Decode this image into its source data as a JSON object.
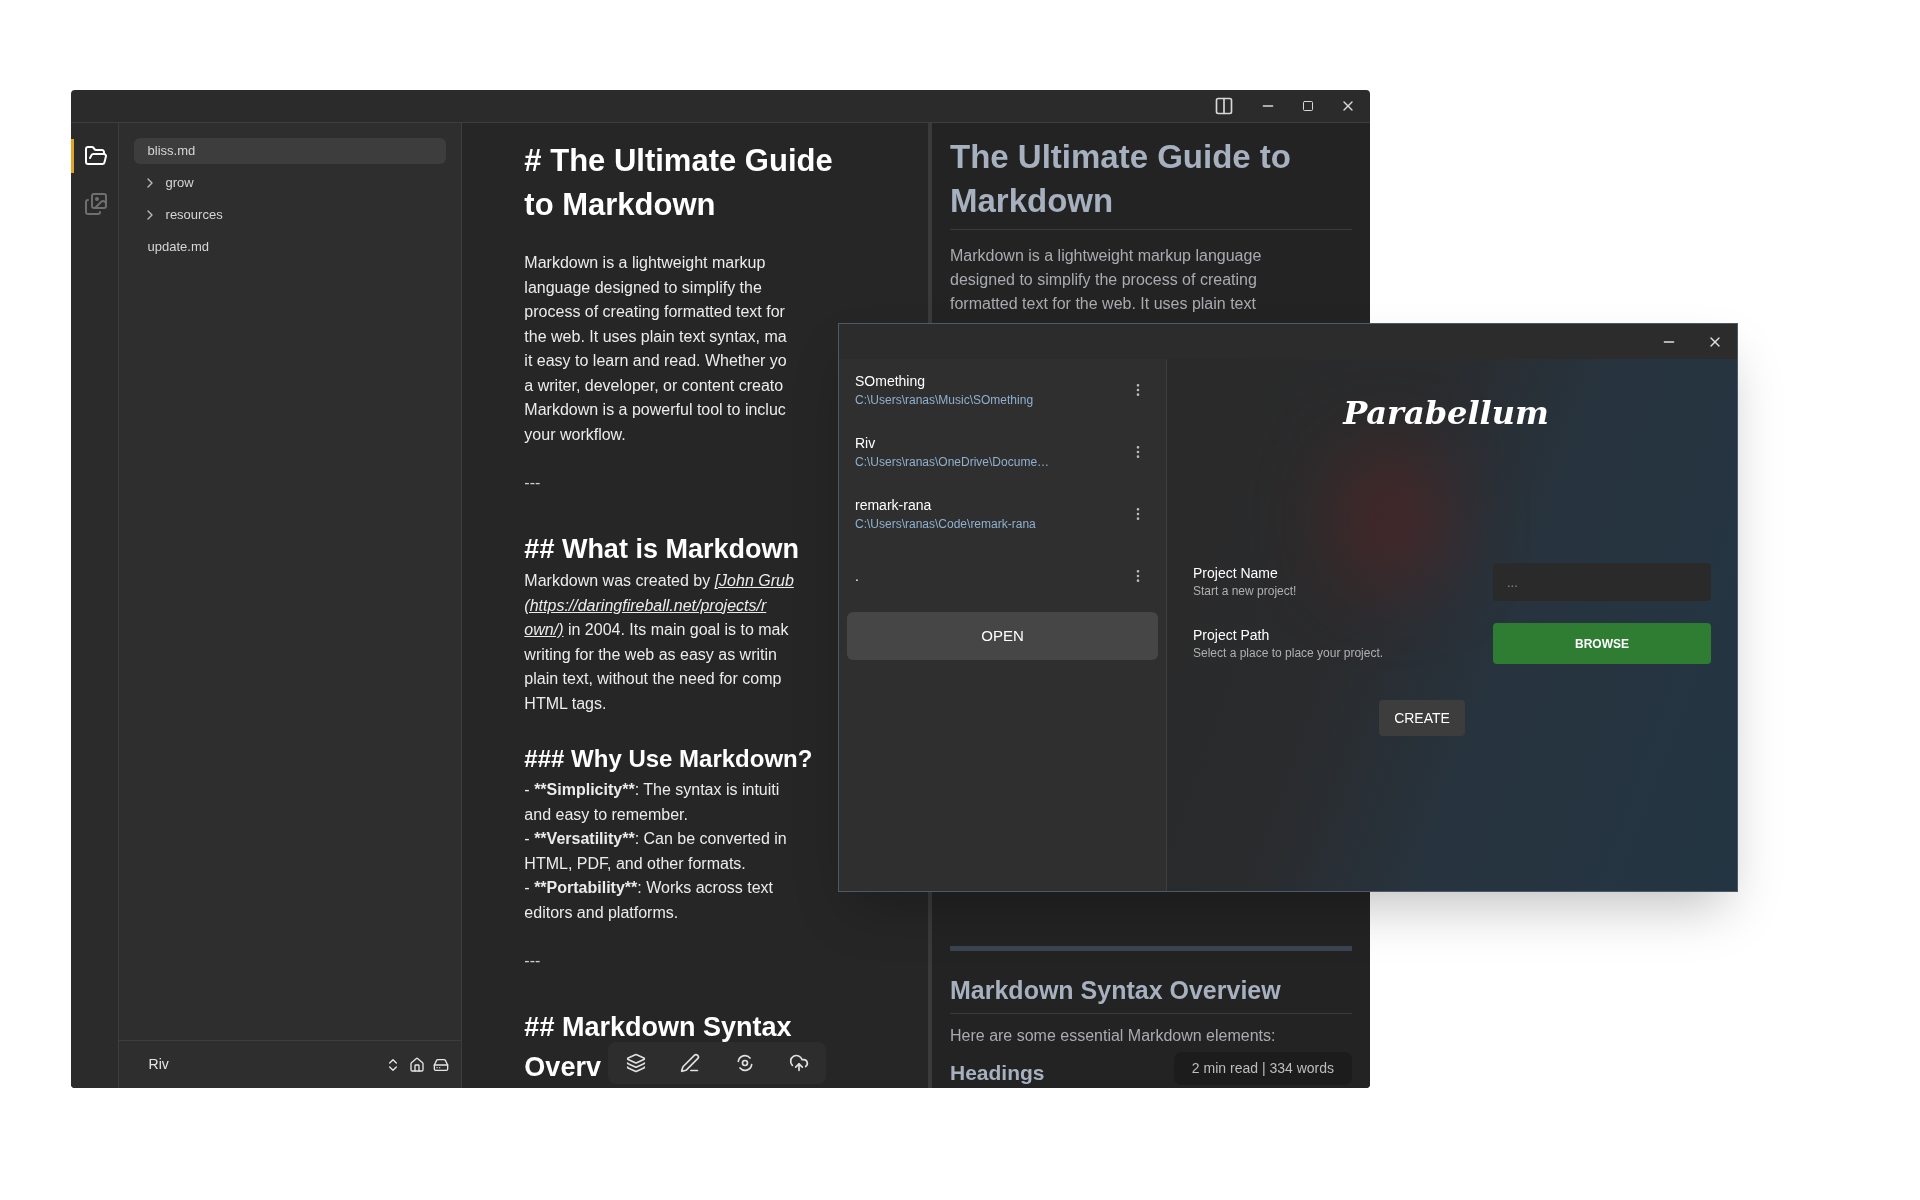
{
  "activity_bar": [
    {
      "kind": "files",
      "selected": true
    },
    {
      "kind": "images",
      "selected": false
    }
  ],
  "file_tree": {
    "items": [
      {
        "name": "bliss.md",
        "kind": "file",
        "selected": true
      },
      {
        "name": "grow",
        "kind": "folder",
        "selected": false
      },
      {
        "name": "resources",
        "kind": "folder",
        "selected": false
      },
      {
        "name": "update.md",
        "kind": "file",
        "selected": false
      }
    ],
    "footer": {
      "project": "Riv"
    }
  },
  "editor": {
    "blocks": [
      {
        "kind": "h1",
        "lines": [
          "# The Ultimate Guide",
          "to Markdown"
        ]
      },
      {
        "kind": "paragraph",
        "lines": [
          "Markdown is a lightweight markup",
          "language designed to simplify the",
          "process of creating formatted text for",
          "the web. It uses plain text syntax, ma",
          "it easy to learn and read. Whether yo",
          "a writer, developer, or content creato",
          "Markdown is a powerful tool to incluc",
          "your workflow."
        ]
      },
      {
        "kind": "rule",
        "lines": [
          "---"
        ]
      },
      {
        "kind": "h2",
        "lines": [
          "## What is Markdown"
        ]
      },
      {
        "kind": "paragraph",
        "lines": [
          [
            {
              "text": "Markdown was created by "
            },
            {
              "text": "[John Grub",
              "kind": "link"
            }
          ],
          [
            {
              "text": "(https://daringfireball.net/projects/r",
              "kind": "link"
            }
          ],
          [
            {
              "text": "own/)",
              "kind": "link"
            },
            {
              "text": " in 2004. Its main goal is to mak"
            }
          ],
          "writing for the web as easy as writin",
          "plain text, without the need for comp",
          "HTML tags."
        ]
      },
      {
        "kind": "h3",
        "lines": [
          "### Why Use Markdown?"
        ]
      },
      {
        "kind": "paragraph",
        "lines": [
          [
            {
              "text": "- "
            },
            {
              "text": "**Simplicity**",
              "kind": "bold"
            },
            {
              "text": ": The syntax is intuiti"
            }
          ],
          "and easy to remember.",
          [
            {
              "text": "- "
            },
            {
              "text": "**Versatility**",
              "kind": "bold"
            },
            {
              "text": ": Can be converted in"
            }
          ],
          "HTML, PDF, and other formats.",
          [
            {
              "text": "- "
            },
            {
              "text": "**Portability**",
              "kind": "bold"
            },
            {
              "text": ": Works across text"
            }
          ],
          "editors and platforms."
        ]
      },
      {
        "kind": "rule",
        "lines": [
          "---"
        ]
      },
      {
        "kind": "h2",
        "lines": [
          "## Markdown Syntax",
          "Overv"
        ]
      }
    ]
  },
  "preview": {
    "title": "The Ultimate Guide to Markdown",
    "intro_lines": [
      "Markdown is a lightweight markup language",
      "designed to simplify the process of creating",
      "formatted text for the web. It uses plain text"
    ],
    "heading": "Markdown Syntax Overview",
    "paragraph": "Here are some essential Markdown elements:",
    "subheading": "Headings",
    "reading_stats": "2 min read | 334 words"
  },
  "dialog": {
    "projects": [
      {
        "name": "SOmething",
        "path": "C:\\Users\\ranas\\Music\\SOmething"
      },
      {
        "name": "Riv",
        "path": "C:\\Users\\ranas\\OneDrive\\Docume…"
      },
      {
        "name": "remark-rana",
        "path": "C:\\Users\\ranas\\Code\\remark-rana"
      },
      {
        "name": "."
      }
    ],
    "open_button": "OPEN",
    "logo": "Parabellum",
    "fields": [
      {
        "kind": "input",
        "label": "Project Name",
        "hint": "Start a new project!",
        "placeholder": "..."
      },
      {
        "kind": "button",
        "label": "Project Path",
        "hint": "Select a place to place your project.",
        "button": "BROWSE"
      }
    ],
    "create_button": "CREATE"
  }
}
